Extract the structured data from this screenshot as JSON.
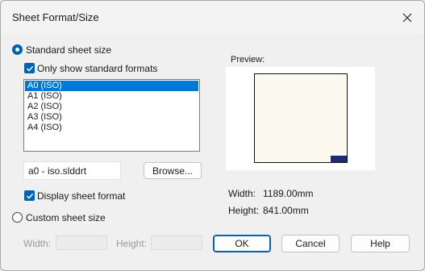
{
  "title": "Sheet Format/Size",
  "standard": {
    "label": "Standard sheet size",
    "only_standard_label": "Only show standard formats",
    "formats": [
      "A0 (ISO)",
      "A1 (ISO)",
      "A2 (ISO)",
      "A3 (ISO)",
      "A4 (ISO)"
    ],
    "selected_index": 0,
    "format_file": "a0 - iso.slddrt",
    "browse_label": "Browse...",
    "display_format_label": "Display sheet format"
  },
  "custom": {
    "label": "Custom sheet size",
    "width_label": "Width:",
    "height_label": "Height:",
    "width_value": "",
    "height_value": ""
  },
  "preview": {
    "label": "Preview:",
    "width_label": "Width:",
    "width_value": "1189.00mm",
    "height_label": "Height:",
    "height_value": "841.00mm"
  },
  "buttons": {
    "ok": "OK",
    "cancel": "Cancel",
    "help": "Help"
  },
  "colors": {
    "accent": "#0063b1",
    "selection": "#0078d7",
    "sheet": "#fcf9ef"
  },
  "icons": {
    "close": "close-icon",
    "check": "checkmark-icon"
  }
}
